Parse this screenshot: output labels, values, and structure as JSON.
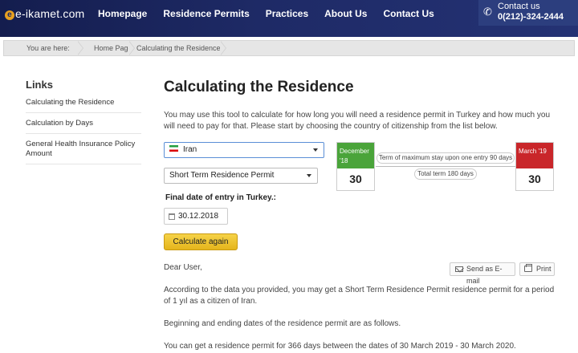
{
  "header": {
    "logo_text": "e-ikamet.com",
    "nav": [
      "Homepage",
      "Residence Permits",
      "Practices",
      "About Us",
      "Contact Us"
    ],
    "contact_label": "Contact us",
    "contact_phone": "0(212)-324-2444"
  },
  "breadcrumb": {
    "prefix": "You are here:",
    "items": [
      "Home Page",
      "Calculating the Residence"
    ]
  },
  "sidebar": {
    "title": "Links",
    "items": [
      "Calculating the Residence",
      "Calculation by Days",
      "General Health Insurance Policy Amount"
    ]
  },
  "main": {
    "title": "Calculating the Residence",
    "intro": "You may use this tool to calculate for how long you will need a residence permit in Turkey and how much you will need to pay for that. Please start by choosing the country of citizenship from the list below.",
    "country": "Iran",
    "permit_type": "Short Term Residence Permit",
    "final_date_label": "Final date of entry in Turkey.:",
    "final_date": "30.12.2018",
    "calc_button": "Calculate again"
  },
  "timeline": {
    "start_label": "December '18",
    "start_day": "30",
    "end_label": "March '19",
    "end_day": "30",
    "max_stay": "Term of maximum stay upon one entry 90 days",
    "total_term": "Total term 180 days",
    "colors": {
      "start": "#4aa43a",
      "end": "#c9262a"
    }
  },
  "result": {
    "dear": "Dear User,",
    "send_email": "Send as E-mail",
    "print": "Print",
    "p1": "According to the data you provided, you may get a Short Term Residence Permit residence permit for a period of 1 yıl as a citizen of Iran.",
    "p2": "Beginning and ending dates of the residence permit are as follows.",
    "p3": "You can get a residence permit for 366 days between the dates of 30 March 2019 - 30 March 2020."
  }
}
